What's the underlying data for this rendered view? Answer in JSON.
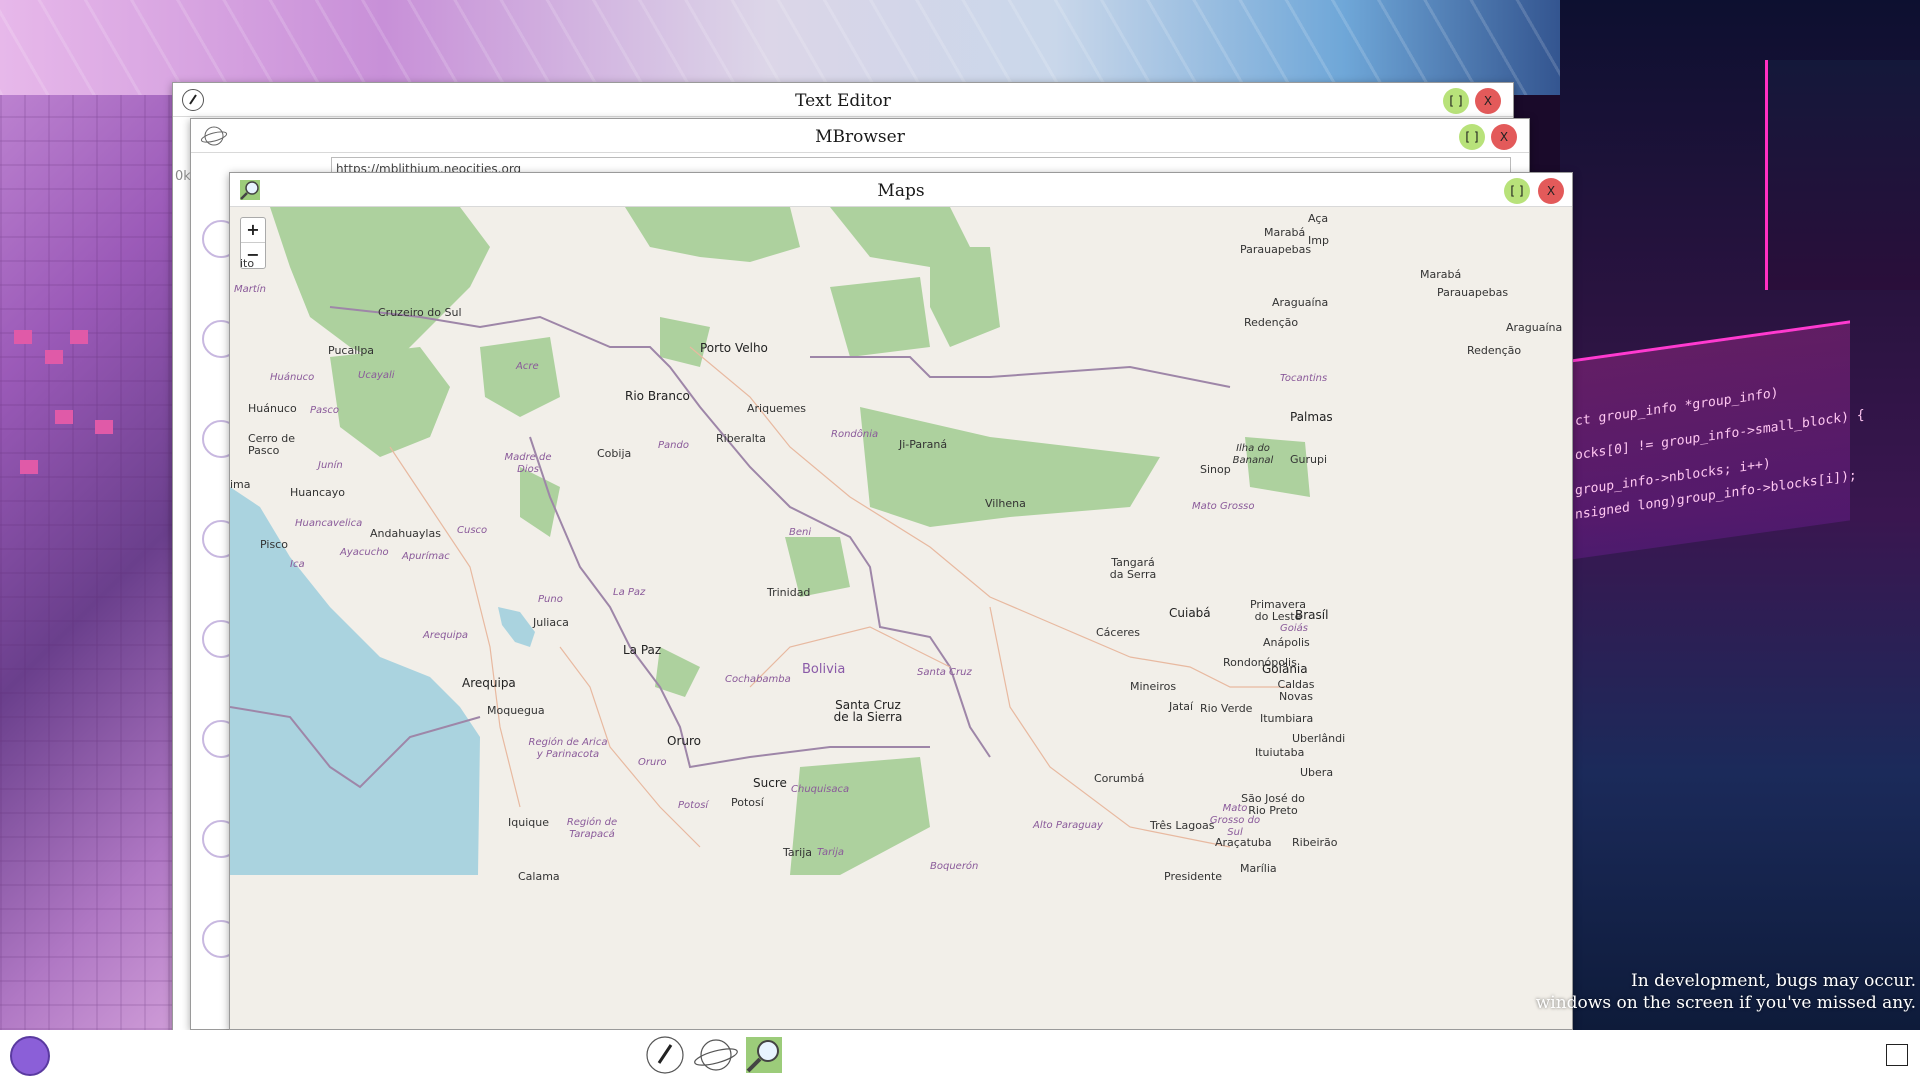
{
  "windows": {
    "text_editor": {
      "title": "Text Editor",
      "max_label": "[ ]",
      "close_label": "X"
    },
    "browser": {
      "title": "MBrowser",
      "max_label": "[ ]",
      "close_label": "X",
      "url": "https://mblithium.neocities.org",
      "side_text": "0k"
    },
    "maps": {
      "title": "Maps",
      "max_label": "[ ]",
      "close_label": "X",
      "zoom_in": "+",
      "zoom_out": "−",
      "labels": {
        "cruzeiro": "Cruzeiro do Sul",
        "porto_velho": "Porto Velho",
        "rio_branco": "Rio Branco",
        "ariquemes": "Ariquemes",
        "pucallpa": "Pucallpa",
        "huanuco": "Huánuco",
        "cerro": "Cerro de Pasco",
        "riberalta": "Riberalta",
        "cobija": "Cobija",
        "ji_parana": "Ji-Paraná",
        "vilhena": "Vilhena",
        "sinop": "Sinop",
        "huancayo": "Huancayo",
        "pisco": "Pisco",
        "andahuaylas": "Andahuaylas",
        "trinidad": "Trinidad",
        "tangara": "Tangará da Serra",
        "cuiaba": "Cuiabá",
        "primavera": "Primavera do Leste",
        "caceres": "Cáceres",
        "juliaca": "Juliaca",
        "la_paz": "La Paz",
        "arequipa": "Arequipa",
        "moquegua": "Moquegua",
        "bolivia": "Bolivia",
        "santa_cruz": "Santa Cruz de la Sierra",
        "rondonopolis": "Rondonópolis",
        "oruro": "Oruro",
        "sucre": "Sucre",
        "potosi": "Potosí",
        "iquique": "Iquique",
        "corumba": "Corumbá",
        "tarija": "Tarija",
        "maraba": "Marabá",
        "parauapebas": "Parauapebas",
        "araguaina": "Araguaína",
        "redencao": "Redenção",
        "palmas": "Palmas",
        "gurupi": "Gurupi",
        "ilha_bananal": "Ilha do Bananal",
        "brasilia": "Brasíl",
        "anapolis": "Anápolis",
        "goiania": "Goiânia",
        "caldas": "Caldas Novas",
        "mineiros": "Mineiros",
        "jatai": "Jataí",
        "rio_verde": "Rio Verde",
        "itumbiara": "Itumbiara",
        "uberlandia": "Uberlândi",
        "ituiutaba": "Ituiutaba",
        "sao_jose": "São José do Rio Preto",
        "tres_lagoas": "Três Lagoas",
        "aracatuba": "Araçatuba",
        "ribeirao": "Ribeirão",
        "marilia": "Marília",
        "presidente": "Presidente",
        "calama": "Calama",
        "acre": "Acre",
        "ucayali": "Ucayali",
        "huanuco_r": "Huánuco",
        "pasco_r": "Pasco",
        "junin": "Junín",
        "madre_dios": "Madre de Dios",
        "pando": "Pando",
        "rondonia": "Rondônia",
        "beni": "Beni",
        "mato_grosso": "Mato Grosso",
        "huancavelica": "Huancavelica",
        "cusco": "Cusco",
        "ayacucho": "Ayacucho",
        "apurimac": "Apurímac",
        "ica": "Ica",
        "puno": "Puno",
        "la_paz_r": "La Paz",
        "arequipa_r": "Arequipa",
        "cochabamba": "Cochabamba",
        "santa_cruz_r": "Santa Cruz",
        "region_arica": "Región de Arica y Parinacota",
        "oruro_r": "Oruro",
        "chuquisaca": "Chuquisaca",
        "potosi_r": "Potosí",
        "region_tarapaca": "Región de Tarapacá",
        "tarija_r": "Tarija",
        "boqueron": "Boquerón",
        "alto_paraguay": "Alto Paraguay",
        "mato_grosso_sul": "Mato Grosso do Sul",
        "goias": "Goiás",
        "tocantins": "Tocantins",
        "martin": "Martín",
        "ima": "ima",
        "ito": "ito",
        "aca": "Aça",
        "imp": "Imp",
        "ubera": "Ubera"
      }
    }
  },
  "desktop": {
    "dev_note_line1": "In development, bugs may occur.",
    "dev_note_line2": "windows on the screen if you've missed any."
  },
  "taskbar": {
    "icons": [
      "start-orb-icon",
      "pencil-icon",
      "planet-icon",
      "magnifier-map-icon",
      "show-desktop-icon"
    ]
  }
}
